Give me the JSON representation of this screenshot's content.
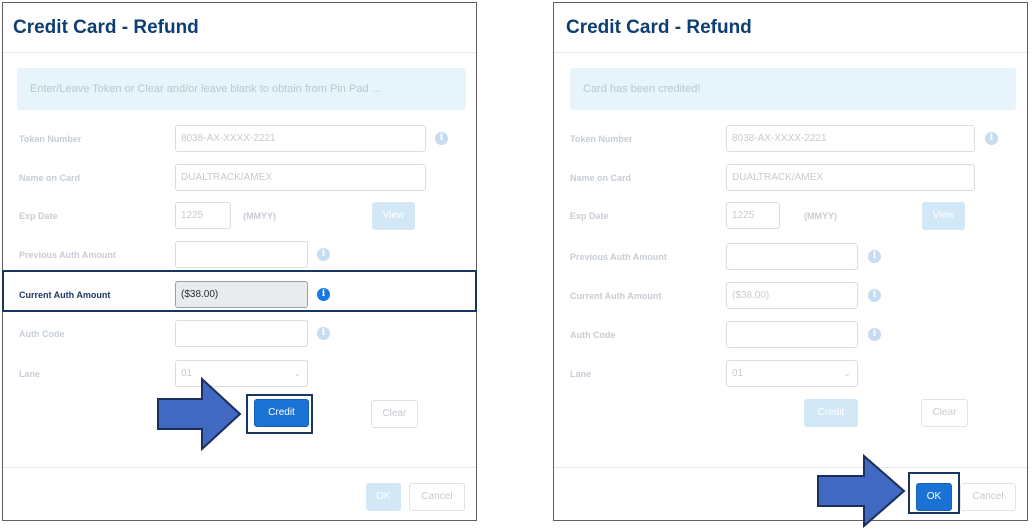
{
  "left_dialog": {
    "title": "Credit Card - Refund",
    "message": "Enter/Leave Token or Clear and/or leave blank to obtain from Pin Pad ...",
    "fields": {
      "token_label": "Token Number",
      "token_value": "8038-AX-XXXX-2221",
      "name_label": "Name on Card",
      "name_value": "DUALTRACK/AMEX",
      "exp_label": "Exp Date",
      "exp_value": "1225",
      "exp_hint": "(MMYY)",
      "prev_auth_label": "Previous Auth Amount",
      "prev_auth_value": "",
      "current_auth_label": "Current Auth Amount",
      "current_auth_value": "($38.00)",
      "auth_code_label": "Auth Code",
      "auth_code_value": "",
      "lane_label": "Lane",
      "lane_value": "01"
    },
    "buttons": {
      "view": "View",
      "credit": "Credit",
      "clear": "Clear",
      "ok": "OK",
      "cancel": "Cancel"
    }
  },
  "right_dialog": {
    "title": "Credit Card - Refund",
    "message": "Card has been credited!",
    "fields": {
      "token_label": "Token Number",
      "token_value": "8038-AX-XXXX-2221",
      "name_label": "Name on Card",
      "name_value": "DUALTRACK/AMEX",
      "exp_label": "Exp Date",
      "exp_value": "1225",
      "exp_hint": "(MMYY)",
      "prev_auth_label": "Previous Auth Amount",
      "prev_auth_value": "",
      "current_auth_label": "Current Auth Amount",
      "current_auth_value": "($38.00)",
      "auth_code_label": "Auth Code",
      "auth_code_value": "",
      "lane_label": "Lane",
      "lane_value": "01"
    },
    "buttons": {
      "view": "View",
      "credit": "Credit",
      "clear": "Clear",
      "ok": "OK",
      "cancel": "Cancel"
    }
  },
  "icons": {
    "info": "i",
    "dropdown": "⌄"
  },
  "colors": {
    "title": "#0f3f72",
    "primary": "#1a73d4",
    "info_active": "#1878e6",
    "callout_arrow": "#4169c1",
    "callout_border": "#17375e"
  }
}
